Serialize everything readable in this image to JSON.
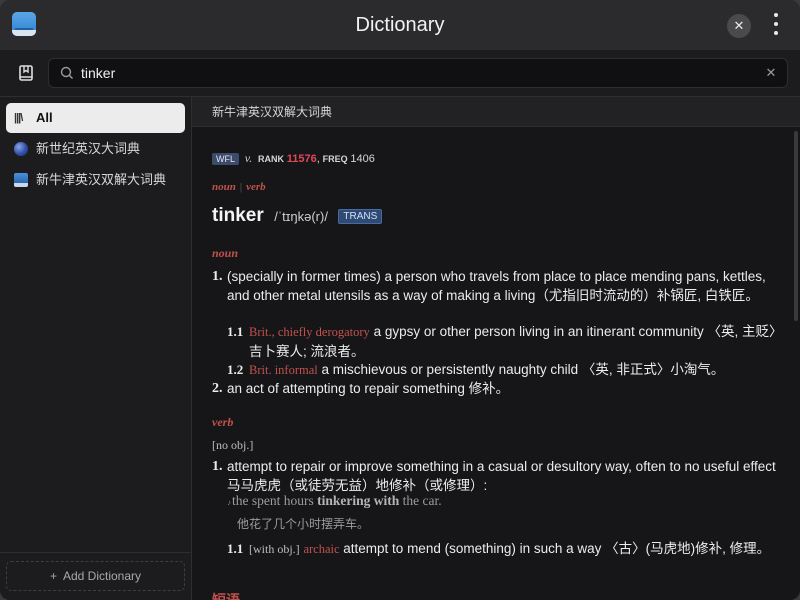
{
  "app": {
    "title": "Dictionary",
    "icon": "dictionary-app-icon"
  },
  "search": {
    "value": "tinker",
    "icon": "search-icon",
    "clear_icon": "clear-icon"
  },
  "sidebar": {
    "items": [
      {
        "label": "All",
        "icon": "library-icon",
        "active": true
      },
      {
        "label": "新世纪英汉大词典",
        "icon": "globe-dictionary-icon",
        "active": false
      },
      {
        "label": "新牛津英汉双解大词典",
        "icon": "book-dictionary-icon",
        "active": false
      }
    ],
    "add_label": "Add Dictionary"
  },
  "content": {
    "header": "新牛津英汉双解大词典",
    "meta": {
      "badge": "WFL",
      "pos": "v.",
      "rank_label": "RANK",
      "rank_value": "11576",
      "freq_label": "FREQ",
      "freq_value": "1406"
    },
    "pos_noun": "noun",
    "pos_sep": "|",
    "pos_verb": "verb",
    "headword": "tinker",
    "pronunciation": "/ˈtɪŋkə(r)/",
    "trans_badge": "TRANS",
    "noun_section": "noun",
    "noun_senses": [
      {
        "num": "1.",
        "text": "(specially in former times) a person who travels from place to place mending pans, kettles, and other metal utensils as a way of making a living（尤指旧时流动的）补锅匠, 白铁匠。"
      },
      {
        "num": "2.",
        "text": "an act of attempting to repair something  修补。"
      }
    ],
    "noun_subsenses": [
      {
        "num": "1.1",
        "register": "Brit., chiefly derogatory",
        "text": "a gypsy or other person living in an itinerant community 〈英, 主贬〉吉卜赛人; 流浪者。"
      },
      {
        "num": "1.2",
        "register": "Brit. informal",
        "text": "a mischievous or persistently naughty child 〈英, 非正式〉小淘气。"
      }
    ],
    "verb_section": "verb",
    "verb_grammar": "[no obj.]",
    "verb_senses": [
      {
        "num": "1.",
        "text": "attempt to repair or improve something in a casual or desultory way, often to no useful effect  马马虎虎（或徒劳无益）地修补（或修理）:"
      }
    ],
    "example": {
      "speaker": "🔊",
      "pre": "the spent hours ",
      "bold": "tinkering with",
      "post": " the car.",
      "translation": "他花了几个小时摆弄车。"
    },
    "verb_subsenses": [
      {
        "num": "1.1",
        "grammar": "[with obj.]",
        "register": "archaic",
        "text": "attempt to mend (something) in such a way 〈古〉(马虎地)修补, 修理。"
      }
    ],
    "phrases_label": "短语"
  },
  "colors": {
    "accent_red": "#c0524e",
    "rank_red": "#e2475a",
    "badge_blue": "#2f4a75",
    "active_bg": "#ececec"
  }
}
